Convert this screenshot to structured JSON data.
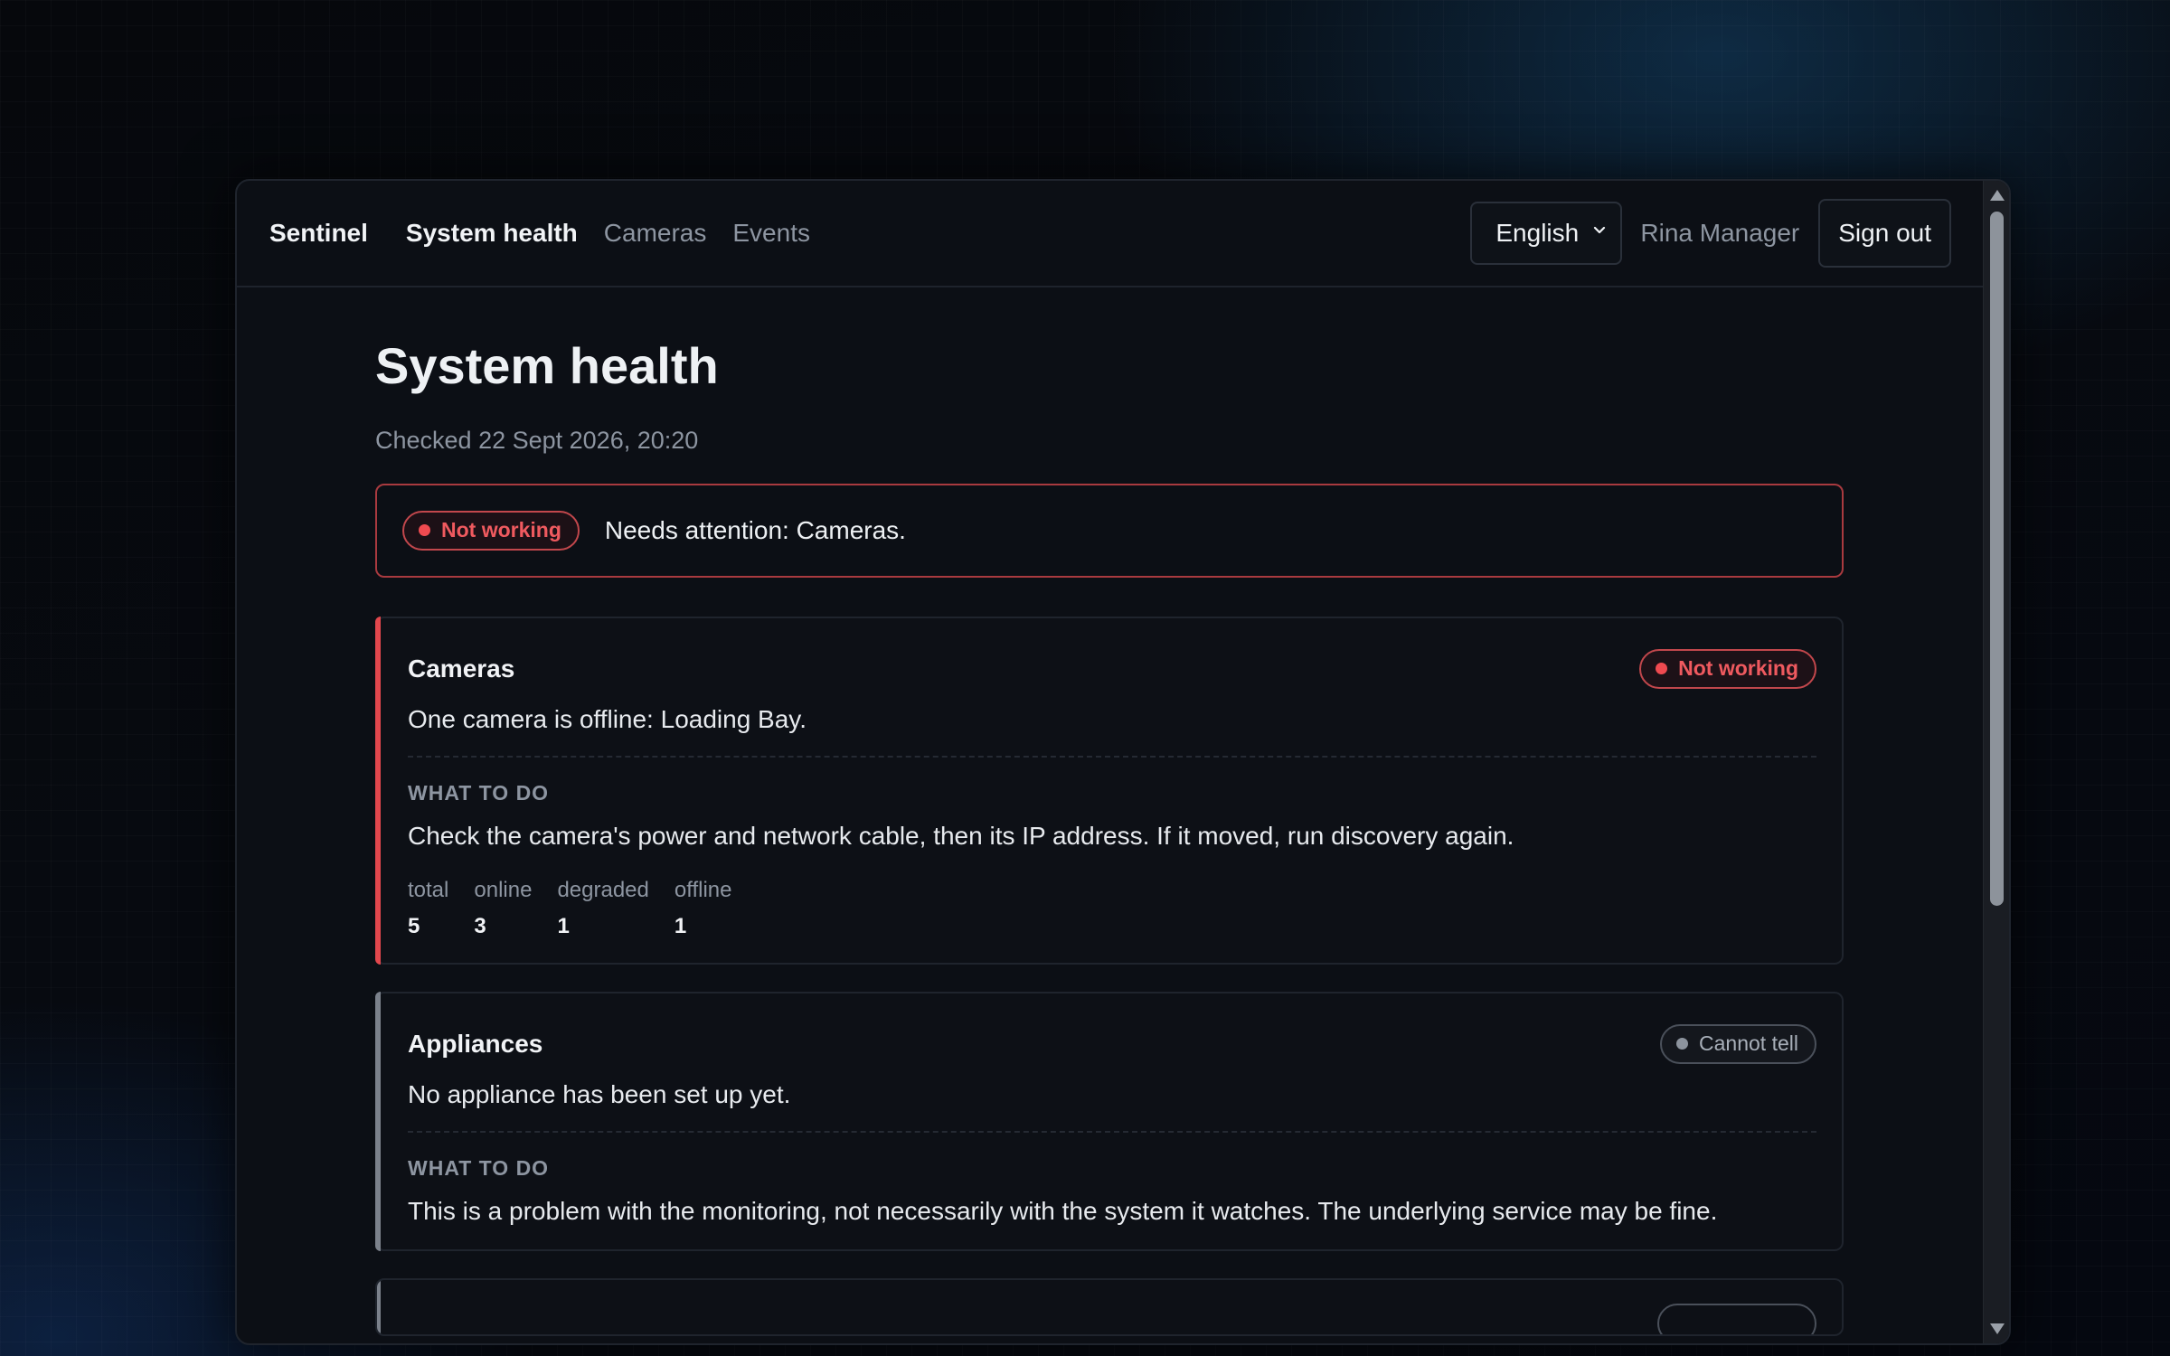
{
  "nav": {
    "brand": "Sentinel",
    "links": [
      "System health",
      "Cameras",
      "Events"
    ],
    "active": "System health",
    "language": "English",
    "user": "Rina Manager",
    "signout_label": "Sign out"
  },
  "page": {
    "title": "System health",
    "checked": "Checked 22 Sept 2026, 20:20"
  },
  "summary": {
    "status": "Not working",
    "text": "Needs attention: Cameras."
  },
  "cards": [
    {
      "title": "Cameras",
      "status": "Not working",
      "status_kind": "bad",
      "description": "One camera is offline: Loading Bay.",
      "what_label": "WHAT TO DO",
      "what_text": "Check the camera's power and network cable, then its IP address. If it moved, run discovery again.",
      "stats": [
        {
          "label": "total",
          "value": "5"
        },
        {
          "label": "online",
          "value": "3"
        },
        {
          "label": "degraded",
          "value": "1"
        },
        {
          "label": "offline",
          "value": "1"
        }
      ]
    },
    {
      "title": "Appliances",
      "status": "Cannot tell",
      "status_kind": "unknown",
      "description": "No appliance has been set up yet.",
      "what_label": "WHAT TO DO",
      "what_text": "This is a problem with the monitoring, not necessarily with the system it watches. The underlying service may be fine."
    }
  ],
  "colors": {
    "bad": "#ef4a50",
    "unknown": "#8c939d",
    "background": "#0c0f15"
  }
}
